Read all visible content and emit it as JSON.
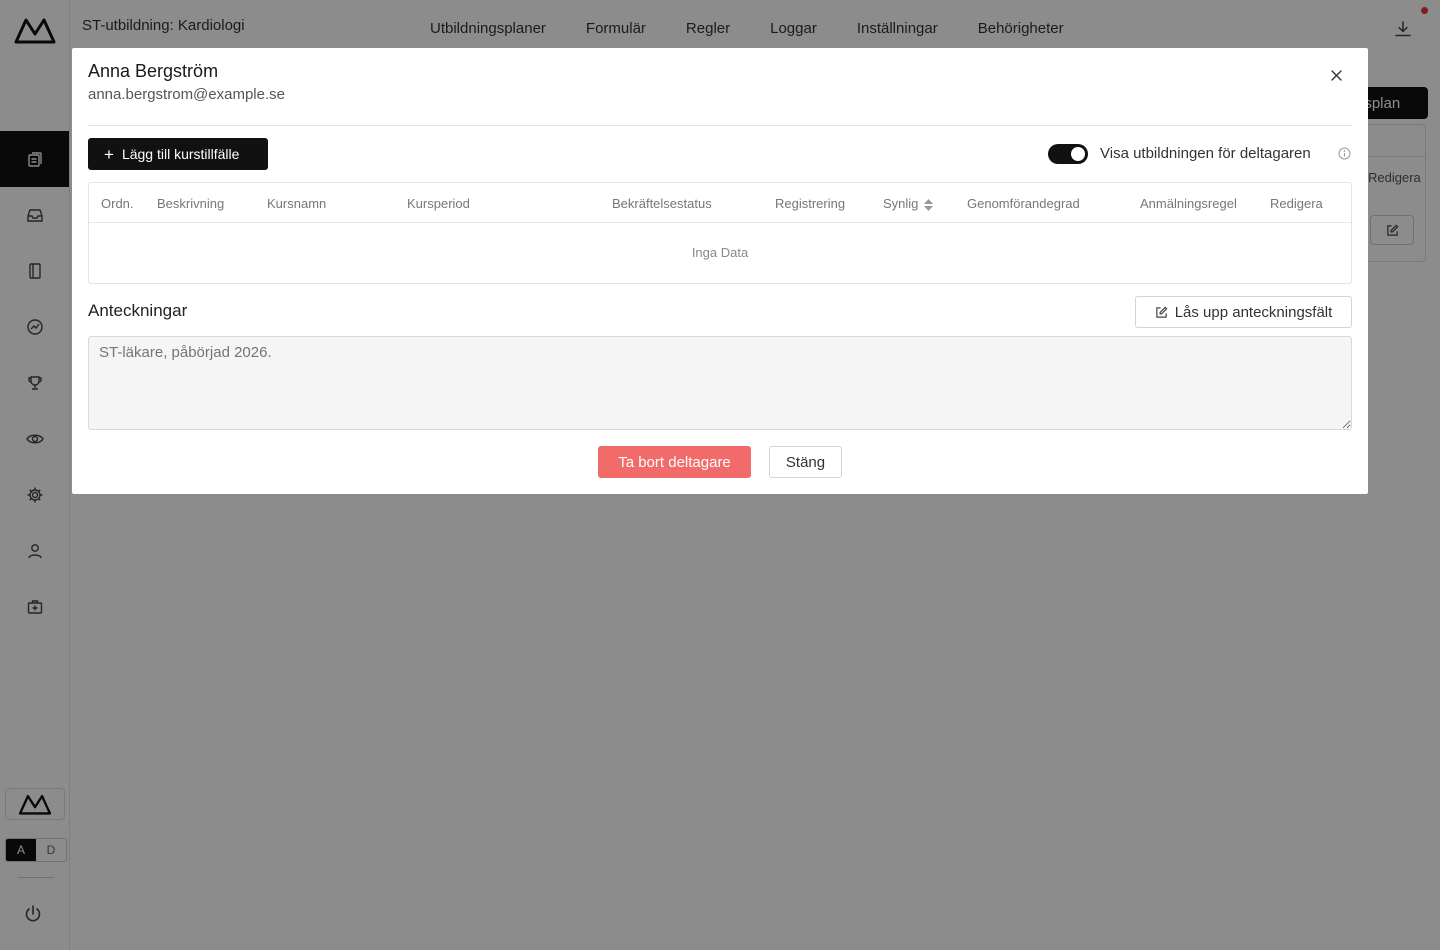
{
  "app": {
    "title": "ST-utbildning: Kardiologi",
    "nav": [
      "Utbildningsplaner",
      "Formulär",
      "Regler",
      "Loggar",
      "Inställningar",
      "Behörigheter"
    ],
    "background_button_label": "gsplan",
    "background_panel_header": "Redigera",
    "lang": {
      "active": "A",
      "inactive": "D"
    },
    "sidebar_icons": [
      "documents-icon",
      "inbox-icon",
      "notebook-icon",
      "analytics-icon",
      "trophy-icon",
      "eye-icon",
      "gear-icon",
      "user-icon",
      "medical-kit-icon"
    ]
  },
  "modal": {
    "name": "Anna Bergström",
    "email": "anna.bergstrom@example.se",
    "add_button": "Lägg till kurstillfälle",
    "visibility_label": "Visa utbildningen för deltagaren",
    "visibility_on": true,
    "table": {
      "columns": [
        "Ordn.",
        "Beskrivning",
        "Kursnamn",
        "Kursperiod",
        "Bekräftelsestatus",
        "Registrering",
        "Synlig",
        "Genomförandegrad",
        "Anmälningsregel",
        "Redigera"
      ],
      "rows": [],
      "empty_text": "Inga Data"
    },
    "notes": {
      "label": "Anteckningar",
      "unlock_button": "Lås upp anteckningsfält",
      "placeholder": "ST-läkare, påbörjad 2026."
    },
    "delete_button": "Ta bort deltagare",
    "close_button": "Stäng"
  },
  "colors": {
    "primary": "#111111",
    "danger": "#f26b6b",
    "notification": "#e53935"
  }
}
